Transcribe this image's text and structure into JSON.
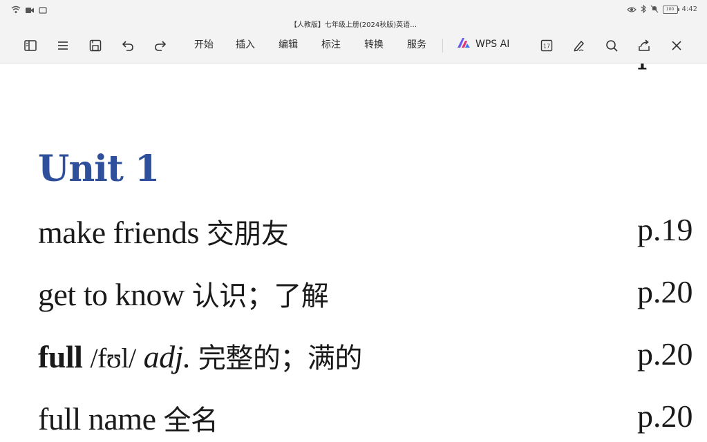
{
  "status_bar": {
    "time": "4:42",
    "battery": "100",
    "left_icons": [
      "wifi-icon",
      "video-icon",
      "square-icon"
    ],
    "right_icons": [
      "eye-icon",
      "bluetooth-icon",
      "mute-icon",
      "battery-icon"
    ]
  },
  "toolbar": {
    "document_title": "【人教版】七年级上册(2024秋版)英语…",
    "icons": [
      "sidebar-icon",
      "menu-icon",
      "save-icon",
      "undo-icon",
      "redo-icon",
      "page-count-icon",
      "pen-icon",
      "search-icon",
      "share-icon",
      "close-icon"
    ],
    "menu": [
      "开始",
      "插入",
      "编辑",
      "标注",
      "转换",
      "服务"
    ],
    "ai_label": "WPS AI",
    "page_badge": "17"
  },
  "document": {
    "cut_off_text": "p",
    "unit_title": "Unit 1",
    "entries": [
      {
        "word": "make friends",
        "phonetic": "",
        "pos": "",
        "meaning": "交朋友",
        "page": "p.19"
      },
      {
        "word": "get to know",
        "phonetic": "",
        "pos": "",
        "meaning": "认识；了解",
        "page": "p.20"
      },
      {
        "word": "full",
        "phonetic": "/fʊl/",
        "pos": "adj.",
        "meaning": "完整的；满的",
        "page": "p.20"
      },
      {
        "word": "full name",
        "phonetic": "",
        "pos": "",
        "meaning": "全名",
        "page": "p.20"
      }
    ],
    "accent_color": "#2e4f9c"
  }
}
